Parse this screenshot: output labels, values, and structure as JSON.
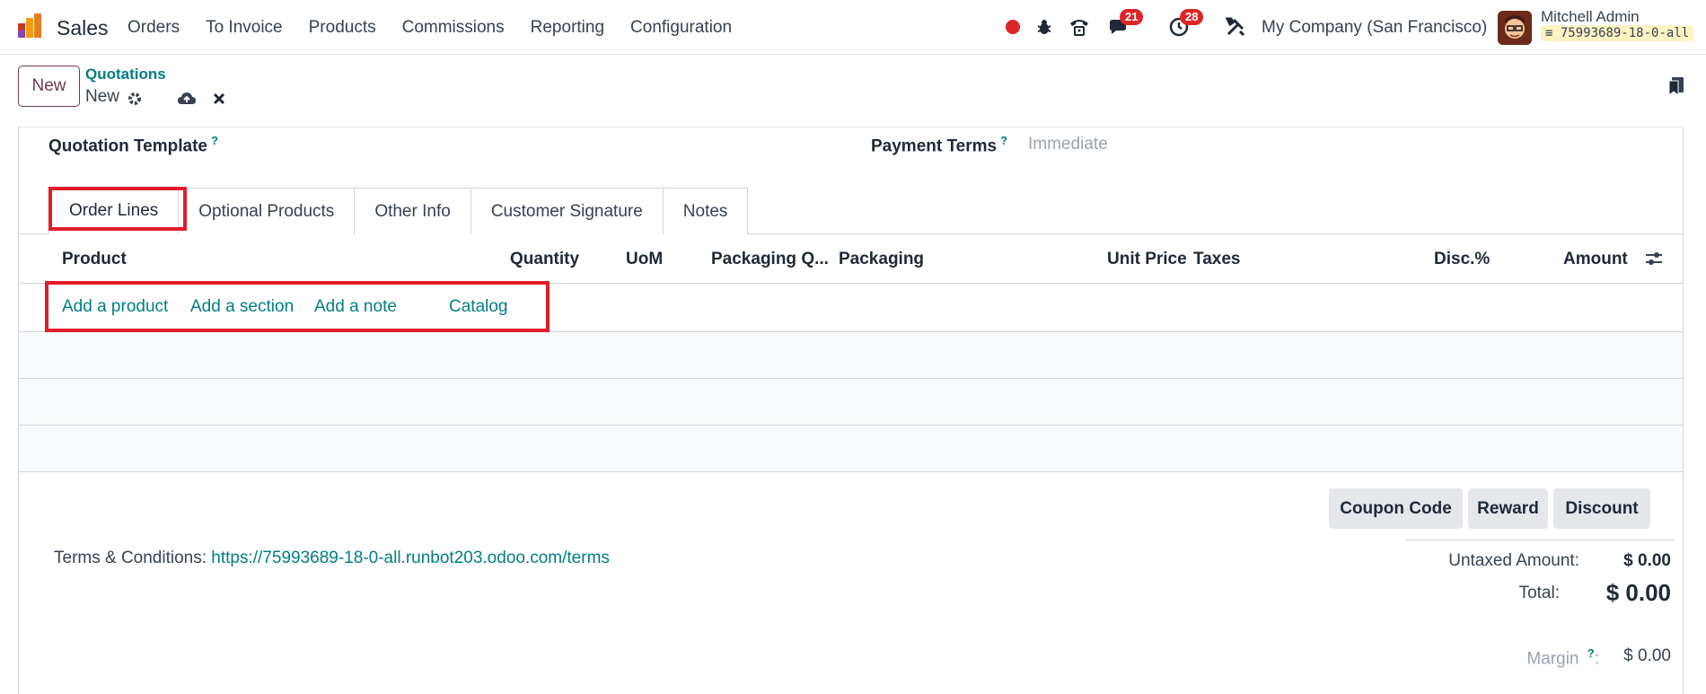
{
  "nav": {
    "app": "Sales",
    "menu": [
      "Orders",
      "To Invoice",
      "Products",
      "Commissions",
      "Reporting",
      "Configuration"
    ],
    "messages_count": "21",
    "activities_count": "28",
    "company": "My Company (San Francisco)",
    "user_name": "Mitchell Admin",
    "database": "75993689-18-0-all"
  },
  "control": {
    "new_label": "New",
    "breadcrumb_parent": "Quotations",
    "breadcrumb_current": "New"
  },
  "form": {
    "quotation_template_label": "Quotation Template",
    "payment_terms_label": "Payment Terms",
    "payment_terms_placeholder": "Immediate",
    "help_mark": "?"
  },
  "tabs": [
    "Order Lines",
    "Optional Products",
    "Other Info",
    "Customer Signature",
    "Notes"
  ],
  "table": {
    "headers": {
      "product": "Product",
      "quantity": "Quantity",
      "uom": "UoM",
      "packaging_qty": "Packaging Q...",
      "packaging": "Packaging",
      "unit_price": "Unit Price",
      "taxes": "Taxes",
      "discount": "Disc.%",
      "amount": "Amount"
    },
    "add_links": {
      "product": "Add a product",
      "section": "Add a section",
      "note": "Add a note",
      "catalog": "Catalog"
    }
  },
  "buttons": {
    "coupon": "Coupon Code",
    "reward": "Reward",
    "discount": "Discount"
  },
  "terms": {
    "label": "Terms & Conditions:",
    "link": "https://75993689-18-0-all.runbot203.odoo.com/terms"
  },
  "totals": {
    "untaxed_label": "Untaxed Amount:",
    "untaxed_value": "$ 0.00",
    "total_label": "Total:",
    "total_value": "$ 0.00",
    "margin_label": "Margin",
    "margin_colon": ":",
    "margin_value": "$ 0.00"
  },
  "colors": {
    "accent": "#017e84",
    "primary": "#71394f",
    "highlight": "#e11d2a",
    "badge": "#dc2626"
  }
}
